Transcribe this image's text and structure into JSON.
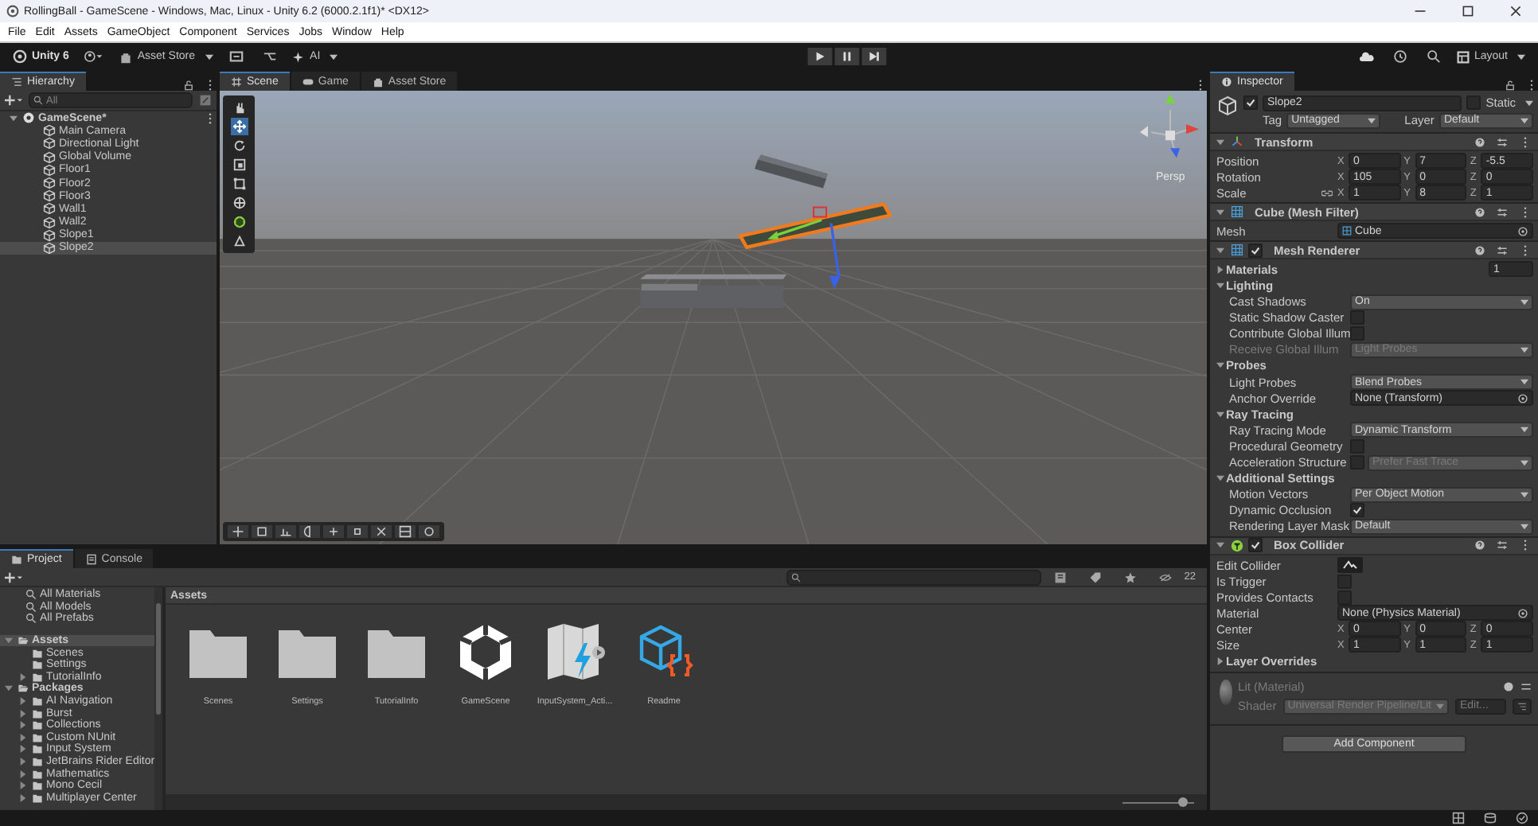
{
  "window": {
    "title": "RollingBall - GameScene - Windows, Mac, Linux - Unity 6.2 (6000.2.1f1)* <DX12>"
  },
  "menu": [
    "File",
    "Edit",
    "Assets",
    "GameObject",
    "Component",
    "Services",
    "Jobs",
    "Window",
    "Help"
  ],
  "toolbar": {
    "brand": "Unity 6",
    "asset_store": "Asset Store",
    "ai": "AI",
    "layout": "Layout"
  },
  "hierarchy": {
    "tab": "Hierarchy",
    "search_placeholder": "All",
    "tree": [
      {
        "label": "GameScene*",
        "kind": "scene",
        "expanded": true,
        "selected": false,
        "children": [
          {
            "label": "Main Camera",
            "kind": "object",
            "selected": false
          },
          {
            "label": "Directional Light",
            "kind": "object",
            "selected": false
          },
          {
            "label": "Global Volume",
            "kind": "object",
            "selected": false
          },
          {
            "label": "Floor1",
            "kind": "object",
            "selected": false
          },
          {
            "label": "Floor2",
            "kind": "object",
            "selected": false
          },
          {
            "label": "Floor3",
            "kind": "object",
            "selected": false
          },
          {
            "label": "Wall1",
            "kind": "object",
            "selected": false
          },
          {
            "label": "Wall2",
            "kind": "object",
            "selected": false
          },
          {
            "label": "Slope1",
            "kind": "object",
            "selected": false
          },
          {
            "label": "Slope2",
            "kind": "object",
            "selected": true
          }
        ]
      }
    ]
  },
  "center_tabs": [
    {
      "label": "Scene",
      "kind": "scene",
      "selected": true
    },
    {
      "label": "Game",
      "kind": "game",
      "selected": false
    },
    {
      "label": "Asset Store",
      "kind": "store",
      "selected": false
    }
  ],
  "scene": {
    "camera_label": "Persp"
  },
  "inspector": {
    "tab": "Inspector",
    "object": {
      "active": true,
      "name": "Slope2",
      "static_label": "Static",
      "static": false,
      "tag_label": "Tag",
      "tag": "Untagged",
      "layer_label": "Layer",
      "layer": "Default"
    },
    "components": [
      {
        "kind": "transform",
        "title": "Transform",
        "rows": [
          {
            "kind": "vec3",
            "label": "Position",
            "values": [
              {
                "axis": "X",
                "value": "0"
              },
              {
                "axis": "Y",
                "value": "7"
              },
              {
                "axis": "Z",
                "value": "-5.5"
              }
            ]
          },
          {
            "kind": "vec3",
            "label": "Rotation",
            "values": [
              {
                "axis": "X",
                "value": "105"
              },
              {
                "axis": "Y",
                "value": "0"
              },
              {
                "axis": "Z",
                "value": "0"
              }
            ]
          },
          {
            "kind": "scale",
            "label": "Scale",
            "values": [
              {
                "axis": "X",
                "value": "1"
              },
              {
                "axis": "Y",
                "value": "8"
              },
              {
                "axis": "Z",
                "value": "1"
              }
            ]
          }
        ]
      },
      {
        "kind": "mesh-filter",
        "title": "Cube (Mesh Filter)",
        "rows": [
          {
            "kind": "mesh-object",
            "label": "Mesh",
            "value": "Cube"
          }
        ]
      },
      {
        "kind": "mesh-renderer",
        "title": "Mesh Renderer",
        "enabled": true,
        "rows": [
          {
            "kind": "section",
            "label": "Materials",
            "expanded": false,
            "value": "1"
          },
          {
            "kind": "section",
            "label": "Lighting",
            "expanded": true,
            "children": [
              {
                "kind": "dropdown",
                "label": "Cast Shadows",
                "value": "On",
                "disabled": false
              },
              {
                "kind": "check",
                "label": "Static Shadow Caster",
                "checked": false
              },
              {
                "kind": "check",
                "label": "Contribute Global Illum",
                "checked": false
              },
              {
                "kind": "dropdown",
                "label": "Receive Global Illum",
                "value": "Light Probes",
                "disabled": true
              }
            ]
          },
          {
            "kind": "section",
            "label": "Probes",
            "expanded": true,
            "children": [
              {
                "kind": "dropdown",
                "label": "Light Probes",
                "value": "Blend Probes",
                "disabled": false
              },
              {
                "kind": "object",
                "label": "Anchor Override",
                "value": "None (Transform)"
              }
            ]
          },
          {
            "kind": "section",
            "label": "Ray Tracing",
            "expanded": true,
            "children": [
              {
                "kind": "dropdown",
                "label": "Ray Tracing Mode",
                "value": "Dynamic Transform",
                "disabled": false
              },
              {
                "kind": "check",
                "label": "Procedural Geometry",
                "checked": false
              },
              {
                "kind": "check-dropdown",
                "label": "Acceleration Structure",
                "checked": false,
                "value": "Prefer Fast Trace",
                "disabled": true
              }
            ]
          },
          {
            "kind": "section",
            "label": "Additional Settings",
            "expanded": true,
            "children": [
              {
                "kind": "dropdown",
                "label": "Motion Vectors",
                "value": "Per Object Motion",
                "disabled": false
              },
              {
                "kind": "check",
                "label": "Dynamic Occlusion",
                "checked": true
              },
              {
                "kind": "dropdown",
                "label": "Rendering Layer Mask",
                "value": "Default",
                "disabled": false
              }
            ]
          }
        ]
      },
      {
        "kind": "box-collider",
        "title": "Box Collider",
        "enabled": true,
        "rows": [
          {
            "kind": "edit-button",
            "label": "Edit Collider"
          },
          {
            "kind": "check",
            "label": "Is Trigger",
            "checked": false
          },
          {
            "kind": "check",
            "label": "Provides Contacts",
            "checked": false
          },
          {
            "kind": "object",
            "label": "Material",
            "value": "None (Physics Material)"
          },
          {
            "kind": "vec3",
            "label": "Center",
            "values": [
              {
                "axis": "X",
                "value": "0"
              },
              {
                "axis": "Y",
                "value": "0"
              },
              {
                "axis": "Z",
                "value": "0"
              }
            ]
          },
          {
            "kind": "vec3",
            "label": "Size",
            "values": [
              {
                "axis": "X",
                "value": "1"
              },
              {
                "axis": "Y",
                "value": "1"
              },
              {
                "axis": "Z",
                "value": "1"
              }
            ]
          },
          {
            "kind": "section",
            "label": "Layer Overrides",
            "expanded": false
          }
        ]
      }
    ],
    "material": {
      "name": "Lit (Material)",
      "shader_label": "Shader",
      "shader": "Universal Render Pipeline/Lit",
      "edit": "Edit..."
    },
    "add_button": "Add Component"
  },
  "bottom_tabs": [
    {
      "label": "Project",
      "kind": "project",
      "selected": true
    },
    {
      "label": "Console",
      "kind": "console",
      "selected": false
    }
  ],
  "project": {
    "hidden_count": "22",
    "breadcrumb": "Assets",
    "zoom": {
      "level": 0.85
    },
    "sidebar": [
      {
        "label": "All Materials",
        "kind": "search",
        "selected": false
      },
      {
        "label": "All Models",
        "kind": "search",
        "selected": false
      },
      {
        "label": "All Prefabs",
        "kind": "search",
        "selected": false
      },
      {
        "label": "Assets",
        "kind": "folder",
        "expanded": true,
        "selected": true,
        "children": [
          {
            "label": "Scenes",
            "kind": "folder",
            "selected": false
          },
          {
            "label": "Settings",
            "kind": "folder",
            "selected": false
          },
          {
            "label": "TutorialInfo",
            "kind": "folder",
            "expanded": false,
            "selected": false
          }
        ]
      },
      {
        "label": "Packages",
        "kind": "folder",
        "expanded": true,
        "selected": false,
        "children": [
          {
            "label": "AI Navigation",
            "kind": "folder",
            "expanded": false,
            "selected": false
          },
          {
            "label": "Burst",
            "kind": "folder",
            "expanded": false,
            "selected": false
          },
          {
            "label": "Collections",
            "kind": "folder",
            "expanded": false,
            "selected": false
          },
          {
            "label": "Custom NUnit",
            "kind": "folder",
            "expanded": false,
            "selected": false
          },
          {
            "label": "Input System",
            "kind": "folder",
            "expanded": false,
            "selected": false
          },
          {
            "label": "JetBrains Rider Editor",
            "kind": "folder",
            "expanded": false,
            "selected": false
          },
          {
            "label": "Mathematics",
            "kind": "folder",
            "expanded": false,
            "selected": false
          },
          {
            "label": "Mono Cecil",
            "kind": "folder",
            "expanded": false,
            "selected": false
          },
          {
            "label": "Multiplayer Center",
            "kind": "folder",
            "expanded": false,
            "selected": false
          }
        ]
      }
    ],
    "assets": [
      {
        "label": "Scenes",
        "kind": "folder"
      },
      {
        "label": "Settings",
        "kind": "folder"
      },
      {
        "label": "TutorialInfo",
        "kind": "folder"
      },
      {
        "label": "GameScene",
        "kind": "scene"
      },
      {
        "label": "InputSystem_Acti...",
        "kind": "input-actions"
      },
      {
        "label": "Readme",
        "kind": "script-asset"
      }
    ]
  }
}
